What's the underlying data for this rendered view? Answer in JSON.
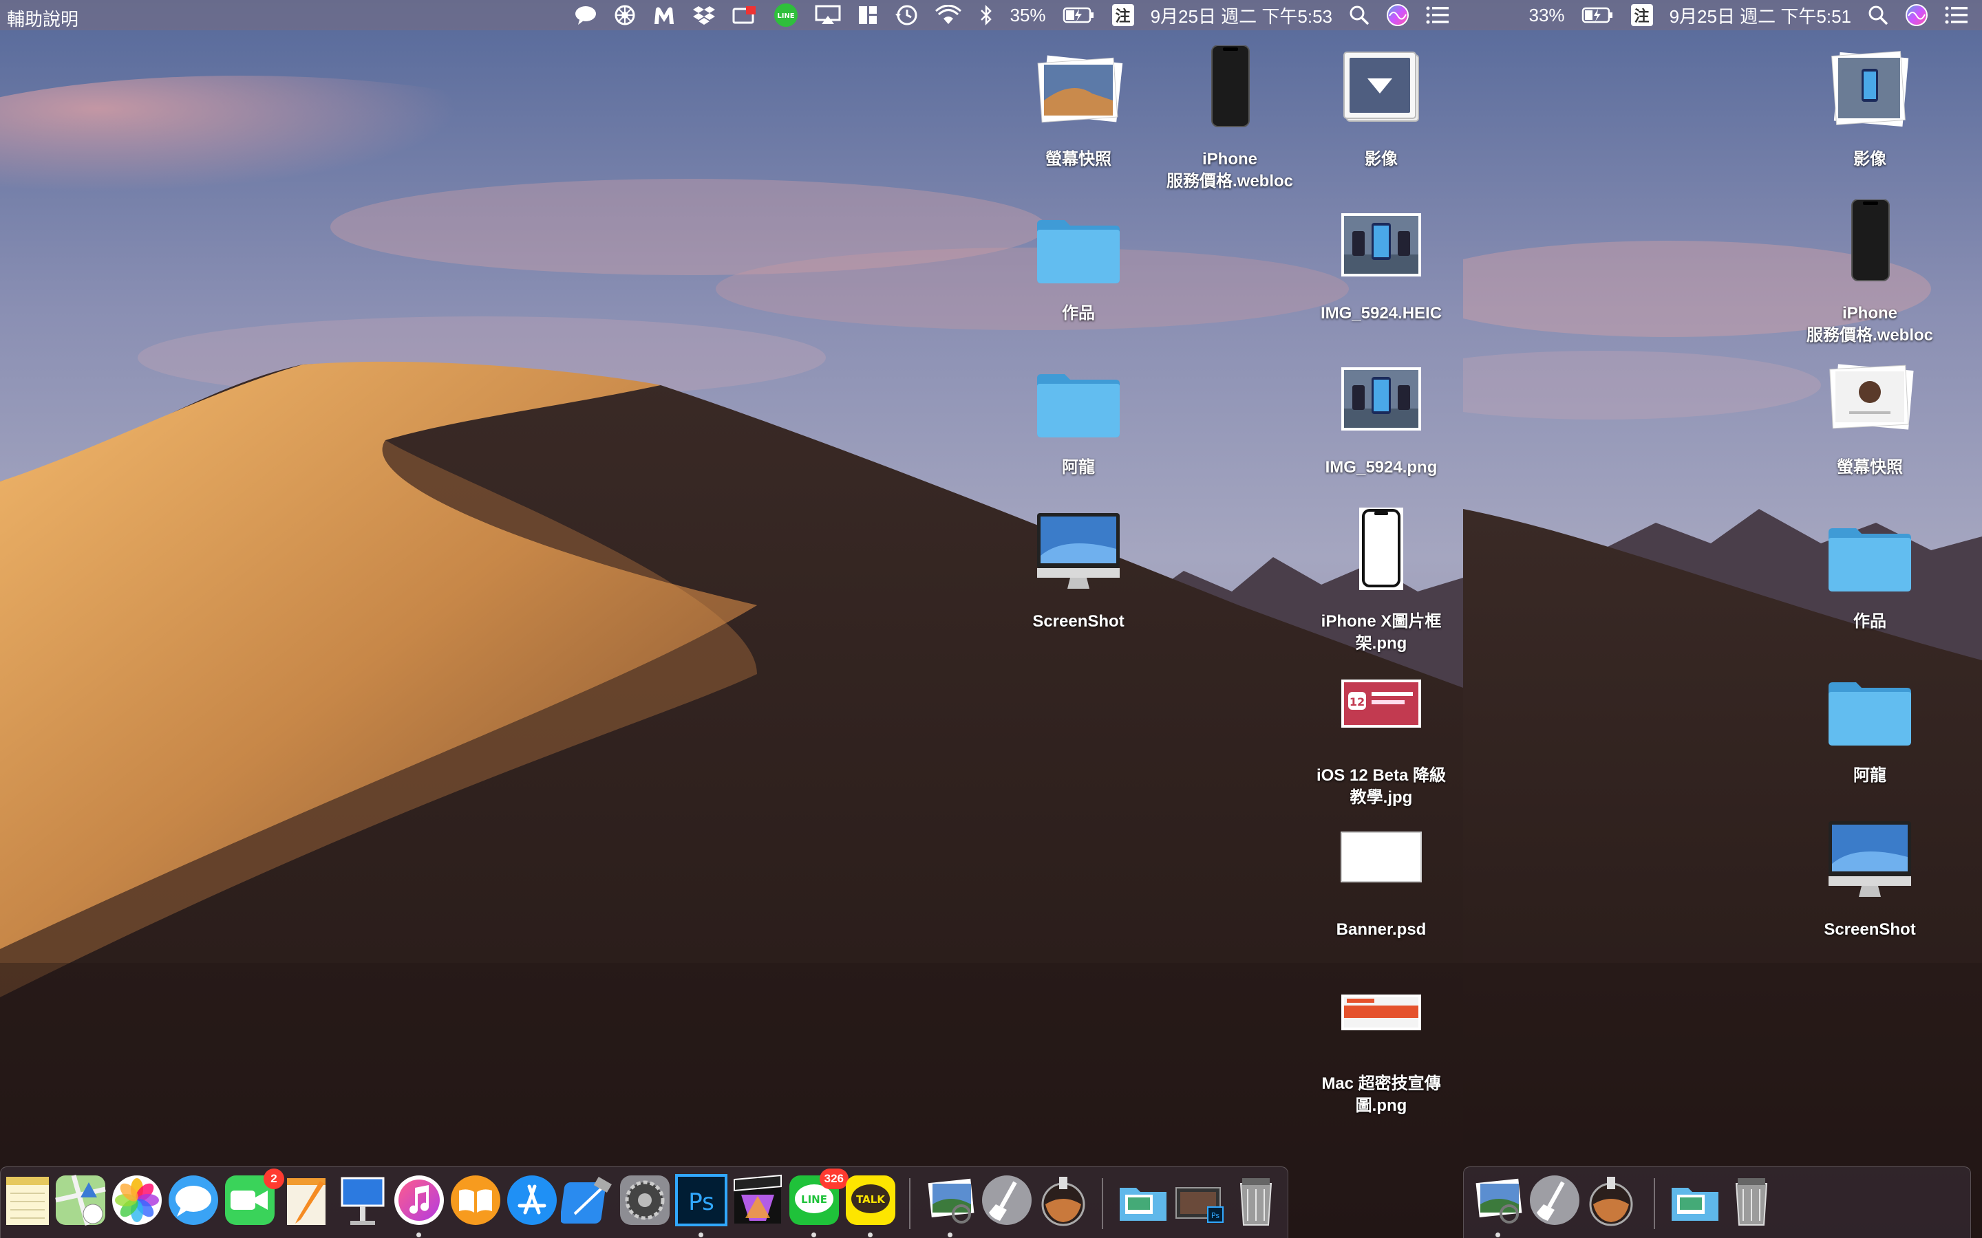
{
  "left_pane": {
    "menubar": {
      "app_menu": "輔助說明",
      "battery": "35%",
      "input_method": "注",
      "datetime": "9月25日 週二 下午5:53",
      "line_label": "LINE"
    },
    "desktop_icons": [
      {
        "label": "螢幕快照"
      },
      {
        "label": "iPhone\n服務價格.webloc"
      },
      {
        "label": "影像"
      },
      {
        "label": "作品"
      },
      {
        "label": "IMG_5924.HEIC"
      },
      {
        "label": "阿龍"
      },
      {
        "label": "IMG_5924.png"
      },
      {
        "label": "ScreenShot"
      },
      {
        "label": "iPhone X圖片框\n架.png"
      },
      {
        "label": "iOS 12 Beta 降級\n教學.jpg"
      },
      {
        "label": "Banner.psd"
      },
      {
        "label": "Mac 超密技宣傳\n圖.png"
      }
    ],
    "dock_badges": {
      "facetime": "2",
      "line": "326"
    },
    "dock_labels": {
      "photoshop": "Ps",
      "kakaotalk": "TALK",
      "line": "LINE",
      "ios_thumb": "12"
    }
  },
  "right_pane": {
    "menubar": {
      "battery": "33%",
      "input_method": "注",
      "datetime": "9月25日 週二 下午5:51"
    },
    "desktop_icons": [
      {
        "label": "影像"
      },
      {
        "label": "iPhone\n服務價格.webloc"
      },
      {
        "label": "螢幕快照"
      },
      {
        "label": "作品"
      },
      {
        "label": "阿龍"
      },
      {
        "label": "ScreenShot"
      }
    ]
  },
  "colors": {
    "folder_blue": "#5fb8ea",
    "badge_red": "#ff3b30",
    "sky_top": "#5b6f9a",
    "dune_light": "#e0a45a"
  }
}
